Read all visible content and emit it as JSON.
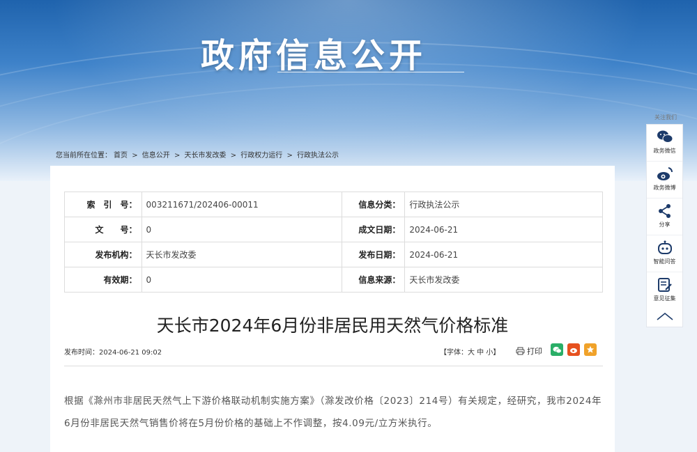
{
  "banner": {
    "title": "政府信息公开"
  },
  "breadcrumb": {
    "prefix": "您当前所在位置：",
    "items": [
      "首页",
      "信息公开",
      "天长市发改委",
      "行政权力运行",
      "行政执法公示"
    ],
    "sep": ">"
  },
  "meta": {
    "index_label": "索　引　号：",
    "index_value": "003211671/202406-00011",
    "category_label": "信息分类：",
    "category_value": "行政执法公示",
    "docno_label": "文　　号：",
    "docno_value": "0",
    "created_label": "成文日期：",
    "created_value": "2024-06-21",
    "org_label": "发布机构：",
    "org_value": "天长市发改委",
    "published_label": "发布日期：",
    "published_value": "2024-06-21",
    "validity_label": "有效期：",
    "validity_value": "0",
    "source_label": "信息来源：",
    "source_value": "天长市发改委"
  },
  "article": {
    "title": "天长市2024年6月份非居民用天然气价格标准",
    "pubtime": "发布时间：2024-06-21 09:02",
    "font_ctrl": "【字体：大 中 小】",
    "print_label": "打印",
    "body": "根据《滁州市非居民天然气上下游价格联动机制实施方案》（滁发改价格〔2023〕214号）有关规定，经研究，我市2024年6月份非居民天然气销售价将在5月份价格的基础上不作调整，按4.09元/立方米执行。"
  },
  "sidebar": {
    "head": "关注我们",
    "items": [
      {
        "label": "政务微信",
        "icon": "wechat-icon"
      },
      {
        "label": "政务微博",
        "icon": "weibo-icon"
      },
      {
        "label": "分享",
        "icon": "share-icon"
      },
      {
        "label": "智能问答",
        "icon": "robot-icon"
      },
      {
        "label": "意见征集",
        "icon": "feedback-icon"
      }
    ],
    "top_icon": "chevron-up-icon"
  },
  "colors": {
    "banner_dark": "#1f63ad",
    "wechat": "#2aae67",
    "weibo": "#e6511f",
    "favorite": "#f0a22a"
  }
}
